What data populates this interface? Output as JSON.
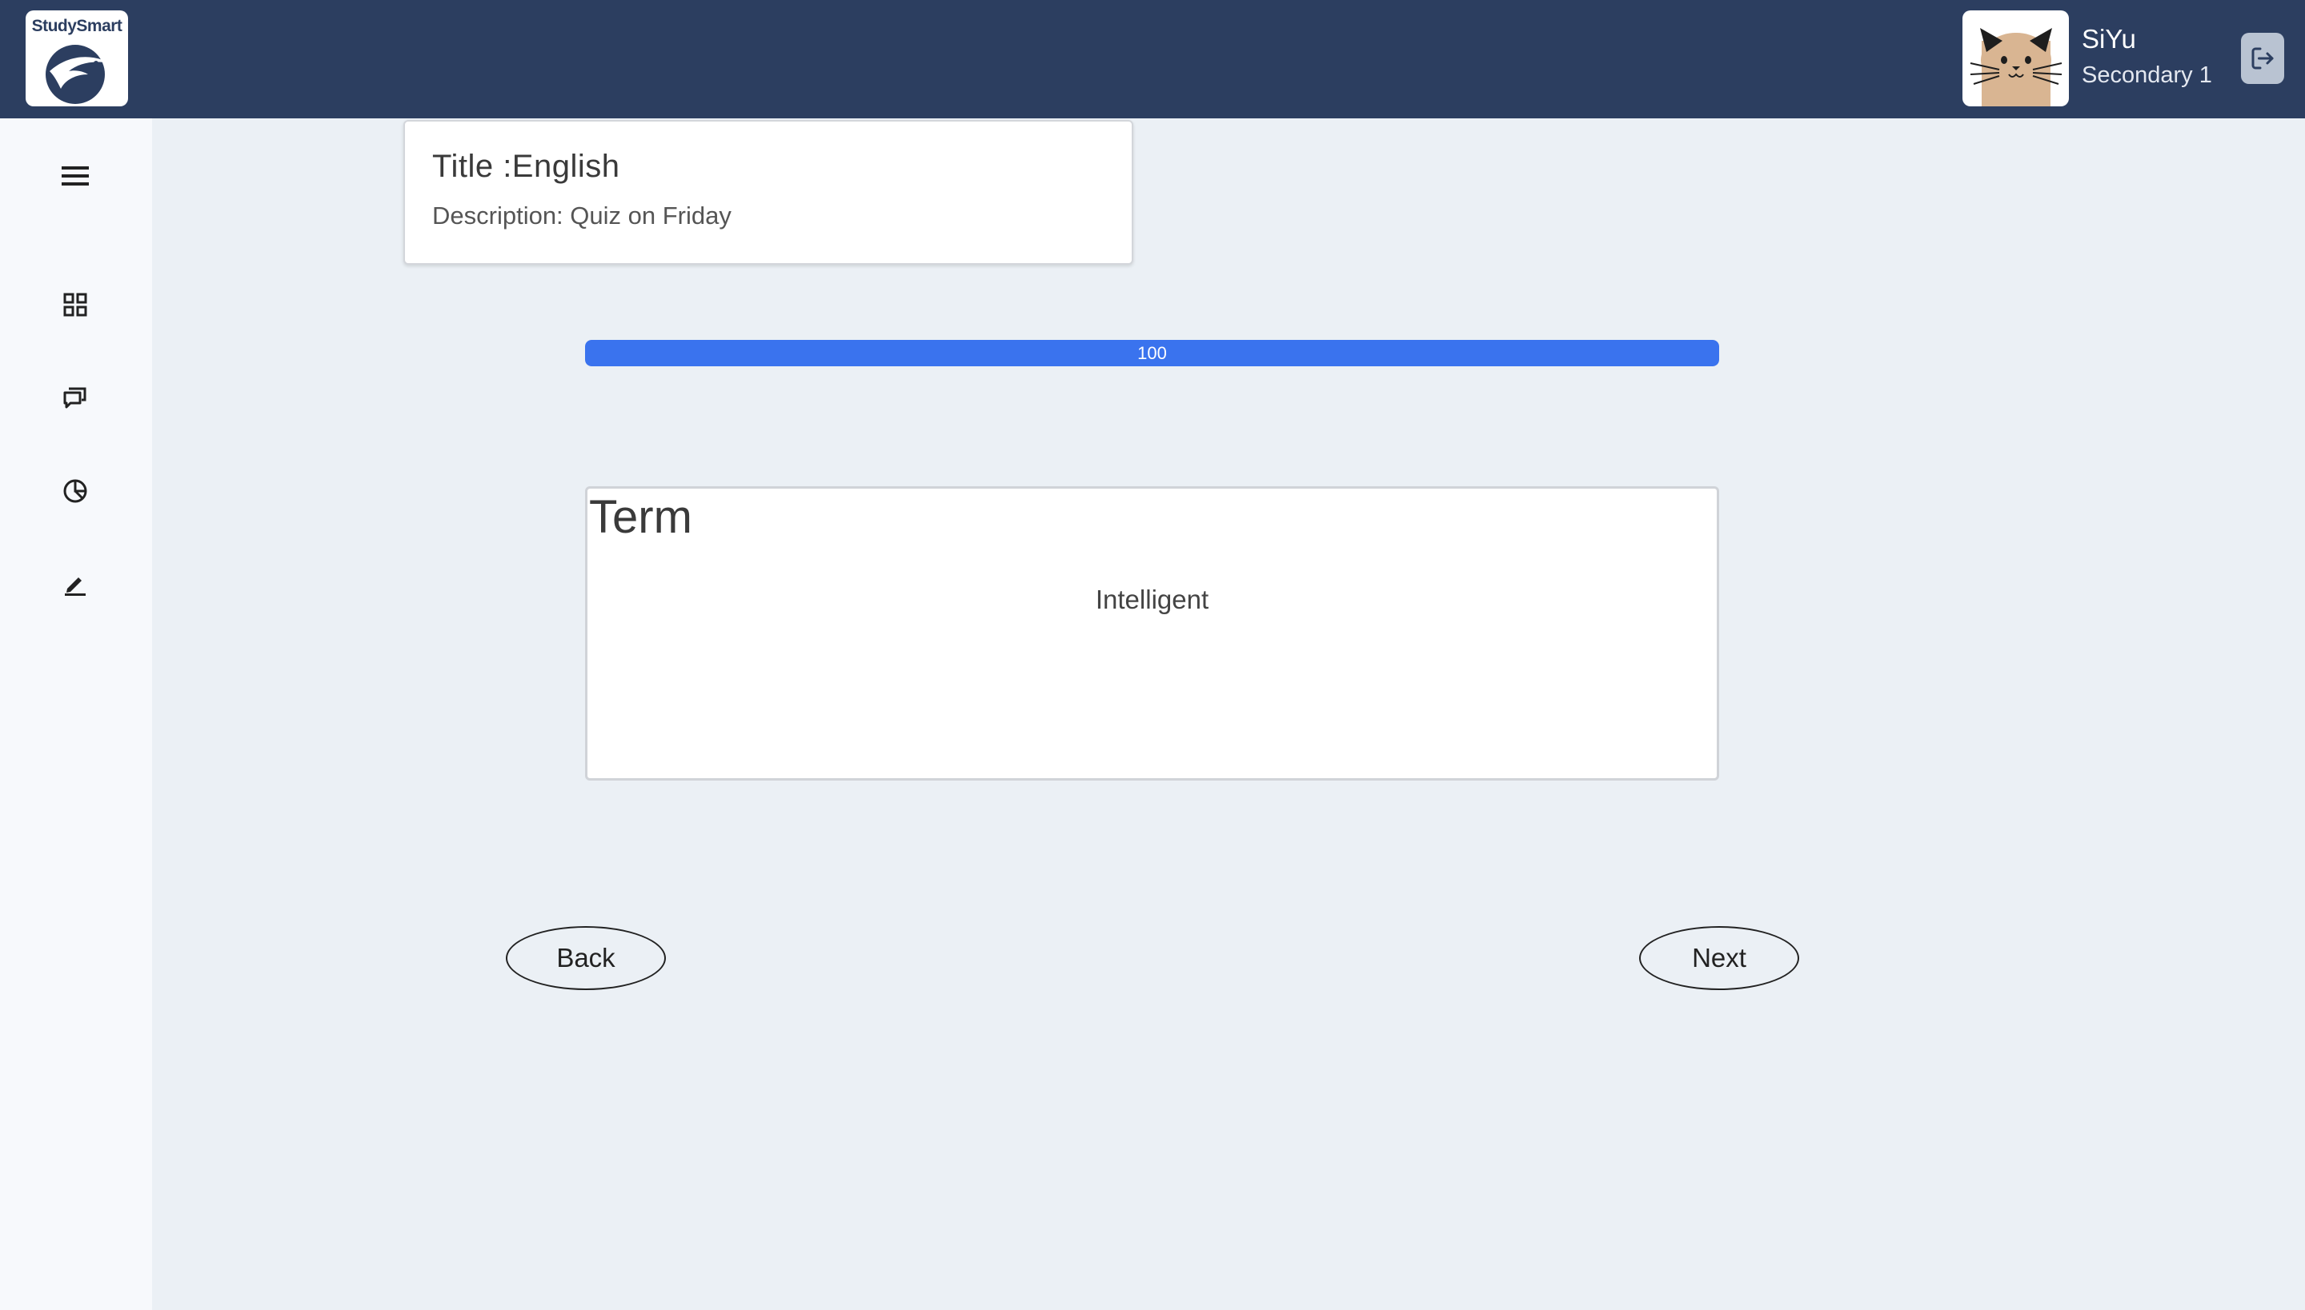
{
  "app": {
    "logo_text": "StudySmart"
  },
  "user": {
    "name": "SiYu",
    "grade": "Secondary 1"
  },
  "sidebar": {
    "items": [
      {
        "icon": "menu-icon"
      },
      {
        "icon": "dashboard-grid-icon"
      },
      {
        "icon": "chat-icon"
      },
      {
        "icon": "pie-chart-icon"
      },
      {
        "icon": "edit-pencil-icon"
      }
    ]
  },
  "quiz": {
    "title": "Title :English",
    "description": "Description: Quiz on Friday"
  },
  "progress": {
    "value": 100,
    "label": "100"
  },
  "flashcard": {
    "heading": "Term",
    "value": "Intelligent"
  },
  "navigation": {
    "back_label": "Back",
    "next_label": "Next"
  },
  "colors": {
    "header": "#2c3e60",
    "page_background": "#ebf0f5",
    "progress_fill": "#3a73ee"
  }
}
